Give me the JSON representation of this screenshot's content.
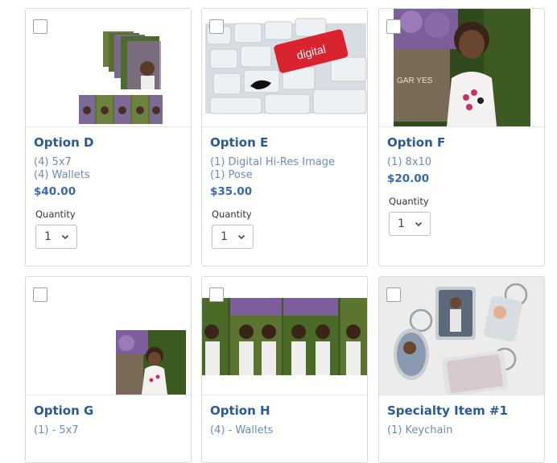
{
  "options": [
    {
      "name": "Option D",
      "lines": [
        "(4) 5x7",
        "(4) Wallets"
      ],
      "price": "$40.00",
      "quantity_label": "Quantity",
      "quantity": "1",
      "image": "photo-package-collage"
    },
    {
      "name": "Option E",
      "lines": [
        "(1) Digital Hi-Res Image",
        "(1) Pose"
      ],
      "price": "$35.00",
      "quantity_label": "Quantity",
      "quantity": "1",
      "image": "keyboard-digital-key",
      "key_text": "digital"
    },
    {
      "name": "Option F",
      "lines": [
        "(1)  8x10"
      ],
      "price": "$20.00",
      "quantity_label": "Quantity",
      "quantity": "1",
      "image": "child-portrait",
      "sign_text": "GAR  YES"
    },
    {
      "name": "Option G",
      "lines": [
        "(1) - 5x7"
      ],
      "price": "",
      "image": "child-portrait-small"
    },
    {
      "name": "Option H",
      "lines": [
        "(4) - Wallets"
      ],
      "price": "",
      "image": "wallet-strip"
    },
    {
      "name": "Specialty Item #1",
      "lines": [
        "(1) Keychain"
      ],
      "price": "",
      "image": "keychains"
    }
  ],
  "colors": {
    "title": "#2a5a9a",
    "desc": "#6d8cb5",
    "price": "#3a67b8",
    "border": "#d5dbe1"
  }
}
